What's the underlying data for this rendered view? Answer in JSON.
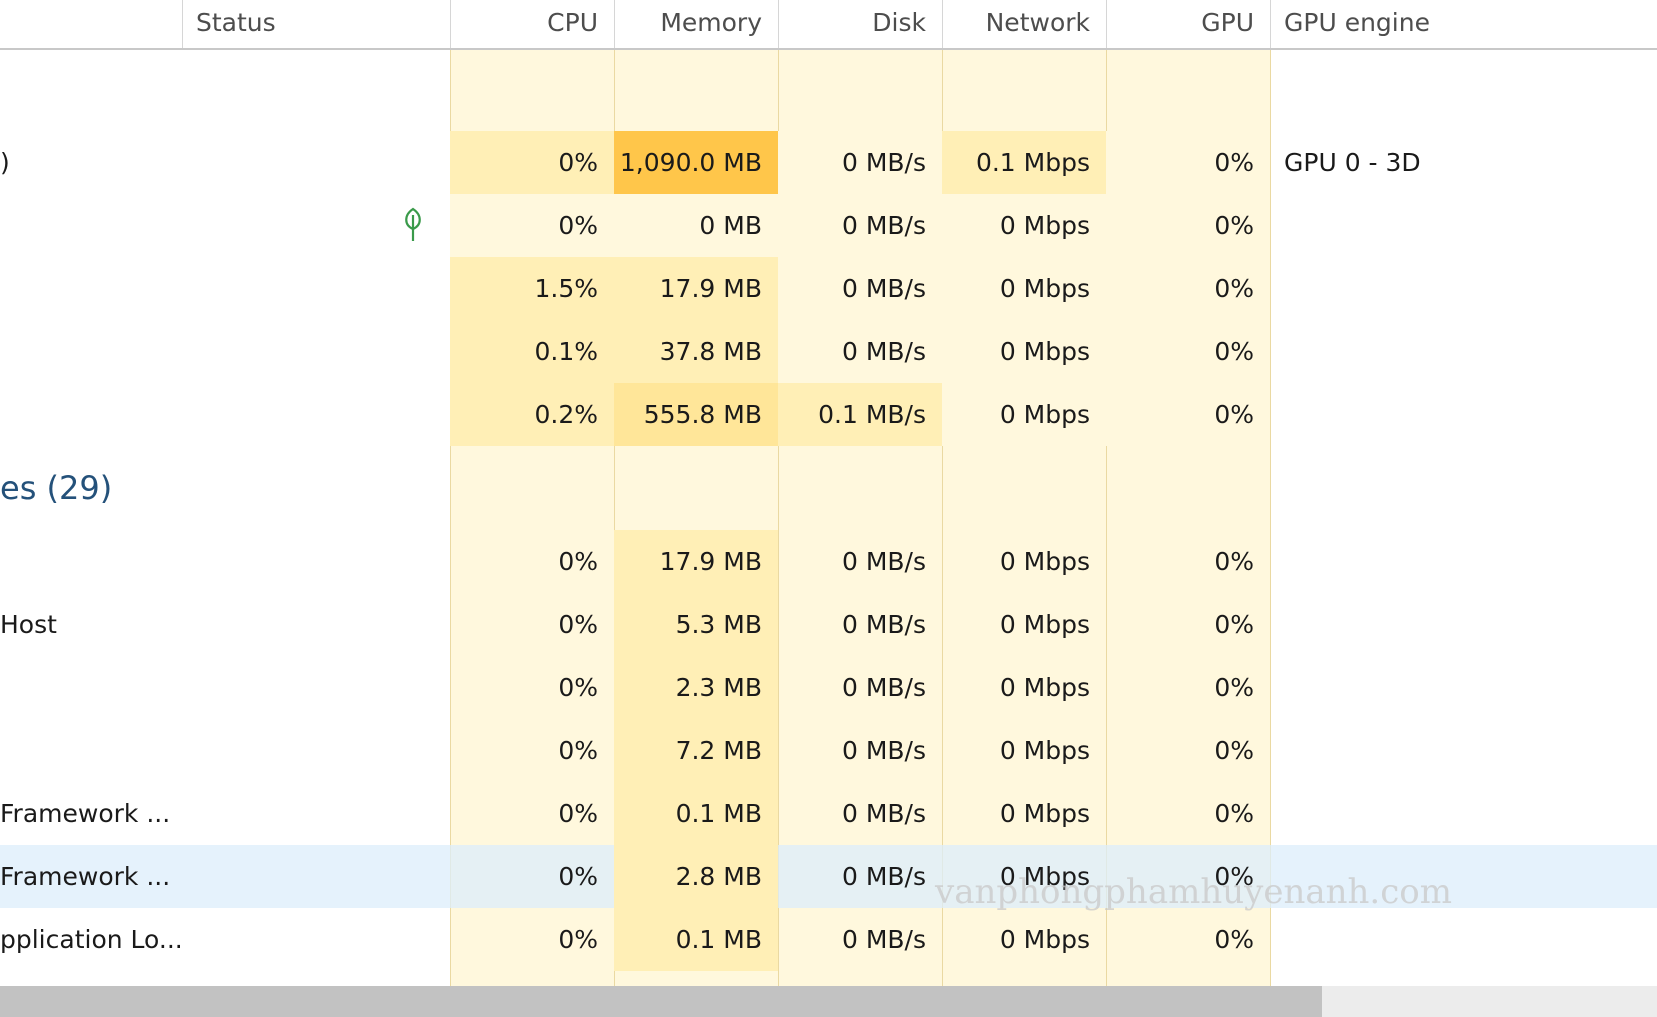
{
  "columns": {
    "status": "Status",
    "cpu": "CPU",
    "memory": "Memory",
    "disk": "Disk",
    "network": "Network",
    "gpu": "GPU",
    "gpu_engine": "GPU engine"
  },
  "colors": {
    "heat_light": "#fff8dd",
    "heat_medium": "#ffefb6",
    "heat_strong": "#ffe699",
    "heat_hot": "#ffc64a",
    "selection": "#dcedfb",
    "group_label": "#24517a"
  },
  "apps_rows": [
    {
      "name": ")",
      "status_icon": "",
      "cpu": "0%",
      "memory": "1,090.0 MB",
      "disk": "0 MB/s",
      "network": "0.1 Mbps",
      "gpu": "0%",
      "gpu_engine": "GPU 0 - 3D",
      "heat": {
        "cpu": "medium",
        "memory": "hot",
        "disk": "light",
        "network": "medium",
        "gpu": "light"
      }
    },
    {
      "name": "",
      "status_icon": "leaf-icon",
      "cpu": "0%",
      "memory": "0 MB",
      "disk": "0 MB/s",
      "network": "0 Mbps",
      "gpu": "0%",
      "gpu_engine": "",
      "heat": {
        "cpu": "light",
        "memory": "light",
        "disk": "light",
        "network": "light",
        "gpu": "light"
      }
    },
    {
      "name": "",
      "status_icon": "",
      "cpu": "1.5%",
      "memory": "17.9 MB",
      "disk": "0 MB/s",
      "network": "0 Mbps",
      "gpu": "0%",
      "gpu_engine": "",
      "heat": {
        "cpu": "medium",
        "memory": "medium",
        "disk": "light",
        "network": "light",
        "gpu": "light"
      }
    },
    {
      "name": "",
      "status_icon": "",
      "cpu": "0.1%",
      "memory": "37.8 MB",
      "disk": "0 MB/s",
      "network": "0 Mbps",
      "gpu": "0%",
      "gpu_engine": "",
      "heat": {
        "cpu": "medium",
        "memory": "medium",
        "disk": "light",
        "network": "light",
        "gpu": "light"
      }
    },
    {
      "name": "",
      "status_icon": "",
      "cpu": "0.2%",
      "memory": "555.8 MB",
      "disk": "0.1 MB/s",
      "network": "0 Mbps",
      "gpu": "0%",
      "gpu_engine": "",
      "heat": {
        "cpu": "medium",
        "memory": "strong",
        "disk": "medium",
        "network": "light",
        "gpu": "light"
      }
    }
  ],
  "group": {
    "label": "es (29)"
  },
  "background_rows": [
    {
      "name": "",
      "cpu": "0%",
      "memory": "17.9 MB",
      "disk": "0 MB/s",
      "network": "0 Mbps",
      "gpu": "0%",
      "selected": false
    },
    {
      "name": "Host",
      "cpu": "0%",
      "memory": "5.3 MB",
      "disk": "0 MB/s",
      "network": "0 Mbps",
      "gpu": "0%",
      "selected": false
    },
    {
      "name": "",
      "cpu": "0%",
      "memory": "2.3 MB",
      "disk": "0 MB/s",
      "network": "0 Mbps",
      "gpu": "0%",
      "selected": false
    },
    {
      "name": "",
      "cpu": "0%",
      "memory": "7.2 MB",
      "disk": "0 MB/s",
      "network": "0 Mbps",
      "gpu": "0%",
      "selected": false
    },
    {
      "name": "Framework ...",
      "cpu": "0%",
      "memory": "0.1 MB",
      "disk": "0 MB/s",
      "network": "0 Mbps",
      "gpu": "0%",
      "selected": false
    },
    {
      "name": "Framework ...",
      "cpu": "0%",
      "memory": "2.8 MB",
      "disk": "0 MB/s",
      "network": "0 Mbps",
      "gpu": "0%",
      "selected": true
    },
    {
      "name": "pplication Lo...",
      "cpu": "0%",
      "memory": "0.1 MB",
      "disk": "0 MB/s",
      "network": "0 Mbps",
      "gpu": "0%",
      "selected": false
    }
  ],
  "watermark": "vanphongphamhuyenanh.com"
}
